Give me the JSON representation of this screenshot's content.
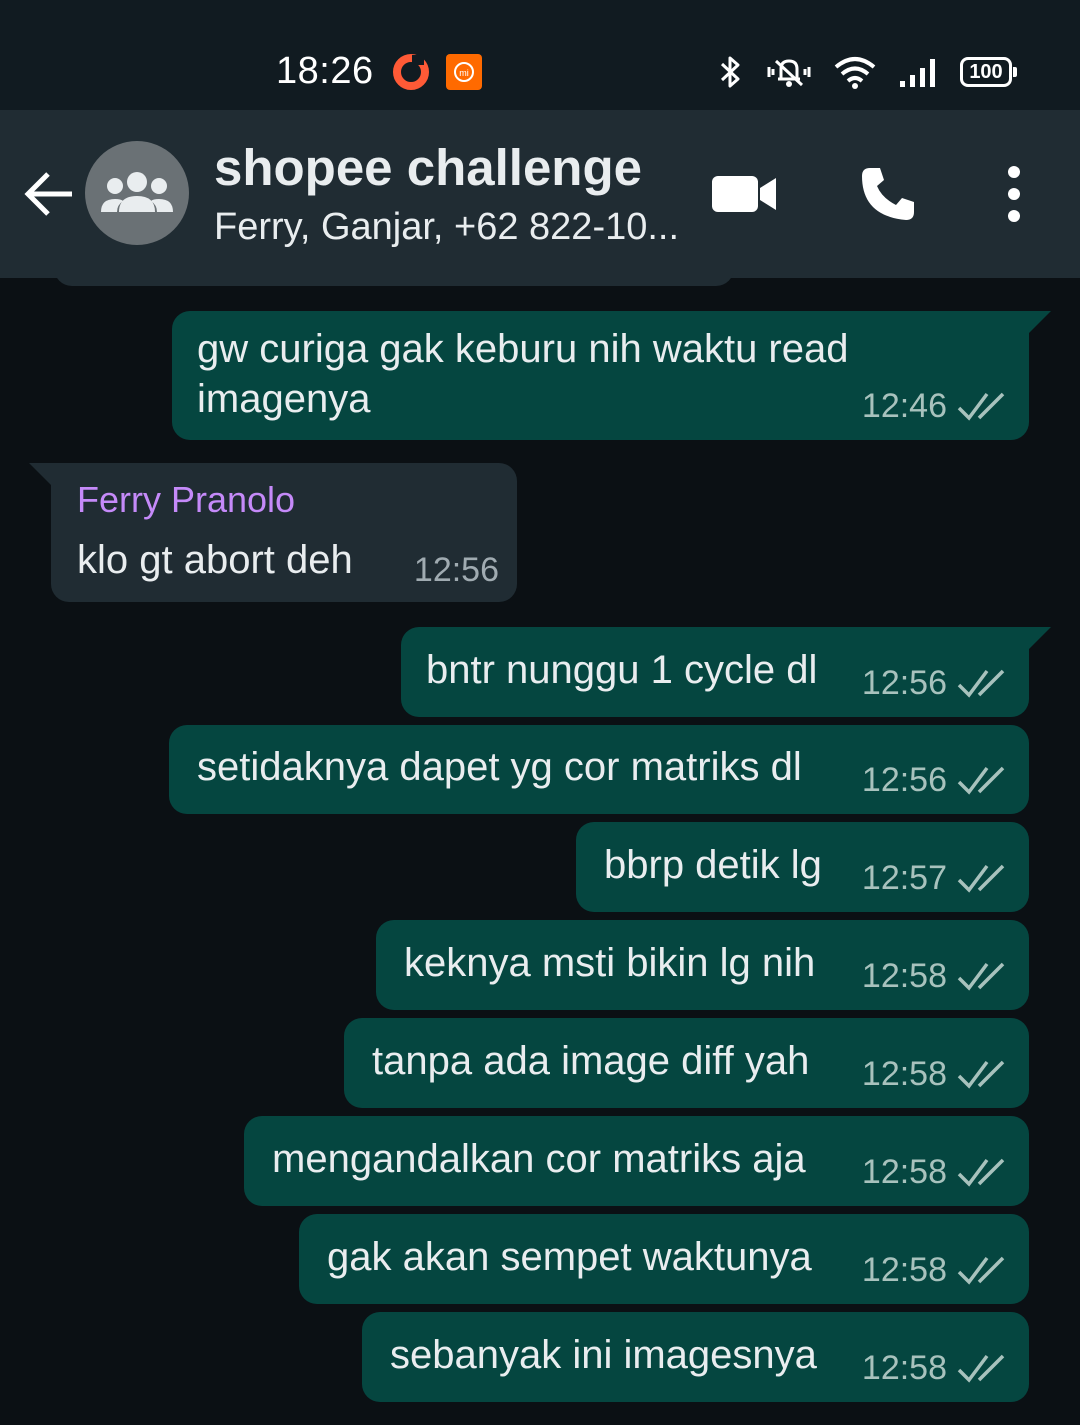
{
  "status_bar": {
    "time": "18:26",
    "battery": "100"
  },
  "header": {
    "title": "shopee challenge",
    "subtitle": "Ferry, Ganjar, +62 822-10..."
  },
  "messages": [
    {
      "type": "out",
      "text_lines": [
        "gw curiga gak keburu nih waktu read",
        "imagenya"
      ],
      "time": "12:46"
    },
    {
      "type": "in",
      "sender": "Ferry Pranolo",
      "text": "klo gt abort deh",
      "time": "12:56"
    },
    {
      "type": "out",
      "text": "bntr nunggu 1 cycle dl",
      "time": "12:56"
    },
    {
      "type": "out",
      "text": "setidaknya dapet yg cor matriks dl",
      "time": "12:56"
    },
    {
      "type": "out",
      "text": "bbrp detik lg",
      "time": "12:57"
    },
    {
      "type": "out",
      "text": "keknya msti bikin lg nih",
      "time": "12:58"
    },
    {
      "type": "out",
      "text": "tanpa ada image diff yah",
      "time": "12:58"
    },
    {
      "type": "out",
      "text": "mengandalkan cor matriks aja",
      "time": "12:58"
    },
    {
      "type": "out",
      "text": "gak akan sempet waktunya",
      "time": "12:58"
    },
    {
      "type": "out",
      "text": "sebanyak ini imagesnya",
      "time": "12:58"
    }
  ],
  "colors": {
    "outgoing_bubble": "#054640",
    "incoming_bubble": "#202c33",
    "sender_name": "#c58af9",
    "background": "#0b1014"
  }
}
